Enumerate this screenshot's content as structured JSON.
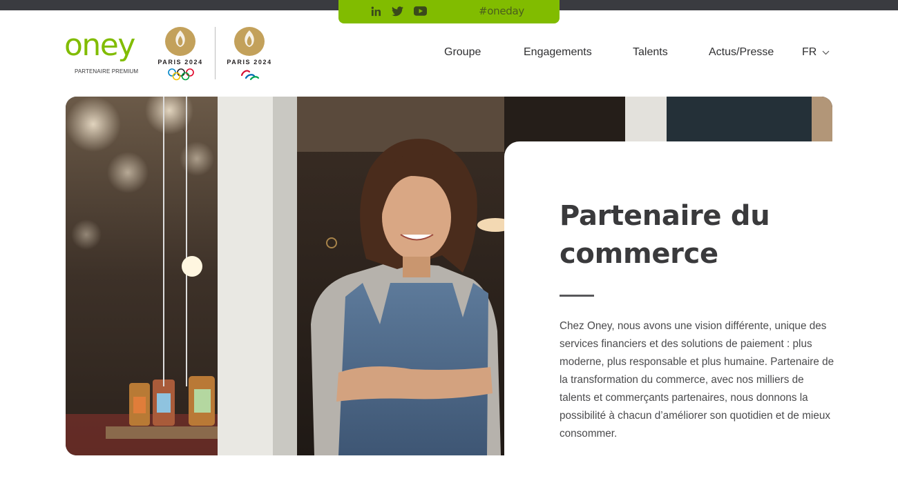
{
  "social": {
    "hashtag": "#oneday",
    "icons": [
      "linkedin-icon",
      "twitter-icon",
      "youtube-icon"
    ]
  },
  "brand": {
    "logo": "oney",
    "tagline": "PARTENAIRE PREMIUM",
    "olympic_label": "PARIS 2024",
    "paralympic_label": "PARIS 2024",
    "accent_color": "#81bc00"
  },
  "nav": {
    "items": [
      "Groupe",
      "Engagements",
      "Talents",
      "Actus/Presse"
    ],
    "language": "FR"
  },
  "hero": {
    "title_line1": "Partenaire du",
    "title_line2": "commerce",
    "body": "Chez Oney, nous avons une vision différente, unique des services financiers et des solutions de paiement : plus moderne, plus responsable et plus humaine. Partenaire de la transformation du commerce, avec nos milliers de talents et commerçants partenaires, nous donnons la possibilité à chacun d’améliorer son quotidien et de mieux consommer."
  }
}
